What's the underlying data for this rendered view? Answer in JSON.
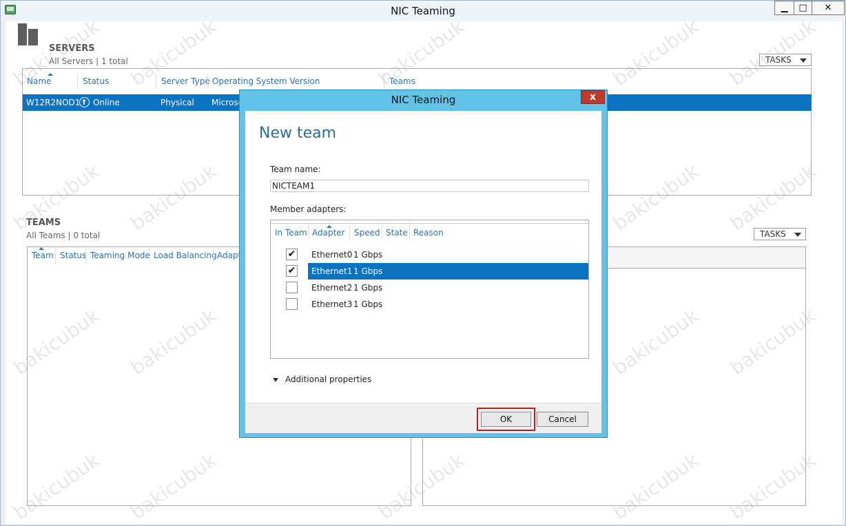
{
  "window": {
    "title": "NIC Teaming",
    "minimize": "▁",
    "maximize": "□",
    "close": "✕"
  },
  "servers": {
    "title": "SERVERS",
    "subtitle": "All Servers | 1 total",
    "tasks": "TASKS",
    "columns": [
      "Name",
      "Status",
      "Server Type",
      "Operating System Version",
      "Teams"
    ],
    "row": {
      "name": "W12R2NOD1",
      "status": "Online",
      "server_type": "Physical",
      "os": "Microsc"
    }
  },
  "teams": {
    "title": "TEAMS",
    "subtitle": "All Teams | 0 total",
    "tasks": "TASKS",
    "columns": [
      "Team",
      "Status",
      "Teaming Mode",
      "Load Balancing",
      "Adapt"
    ]
  },
  "dialog": {
    "title": "NIC Teaming",
    "close": "x",
    "heading": "New team",
    "team_name_label": "Team name:",
    "team_name_value": "NICTEAM1",
    "member_adapters_label": "Member adapters:",
    "columns": [
      "In Team",
      "Adapter",
      "Speed",
      "State",
      "Reason"
    ],
    "adapters": [
      {
        "name": "Ethernet0",
        "speed": "1 Gbps",
        "in_team": true,
        "check": "✔"
      },
      {
        "name": "Ethernet1",
        "speed": "1 Gbps",
        "in_team": true,
        "check": "✔"
      },
      {
        "name": "Ethernet2",
        "speed": "1 Gbps",
        "in_team": false,
        "check": ""
      },
      {
        "name": "Ethernet3",
        "speed": "1 Gbps",
        "in_team": false,
        "check": ""
      }
    ],
    "additional_properties": "Additional properties",
    "ok": "OK",
    "cancel": "Cancel"
  },
  "watermark": "bakicubuk"
}
